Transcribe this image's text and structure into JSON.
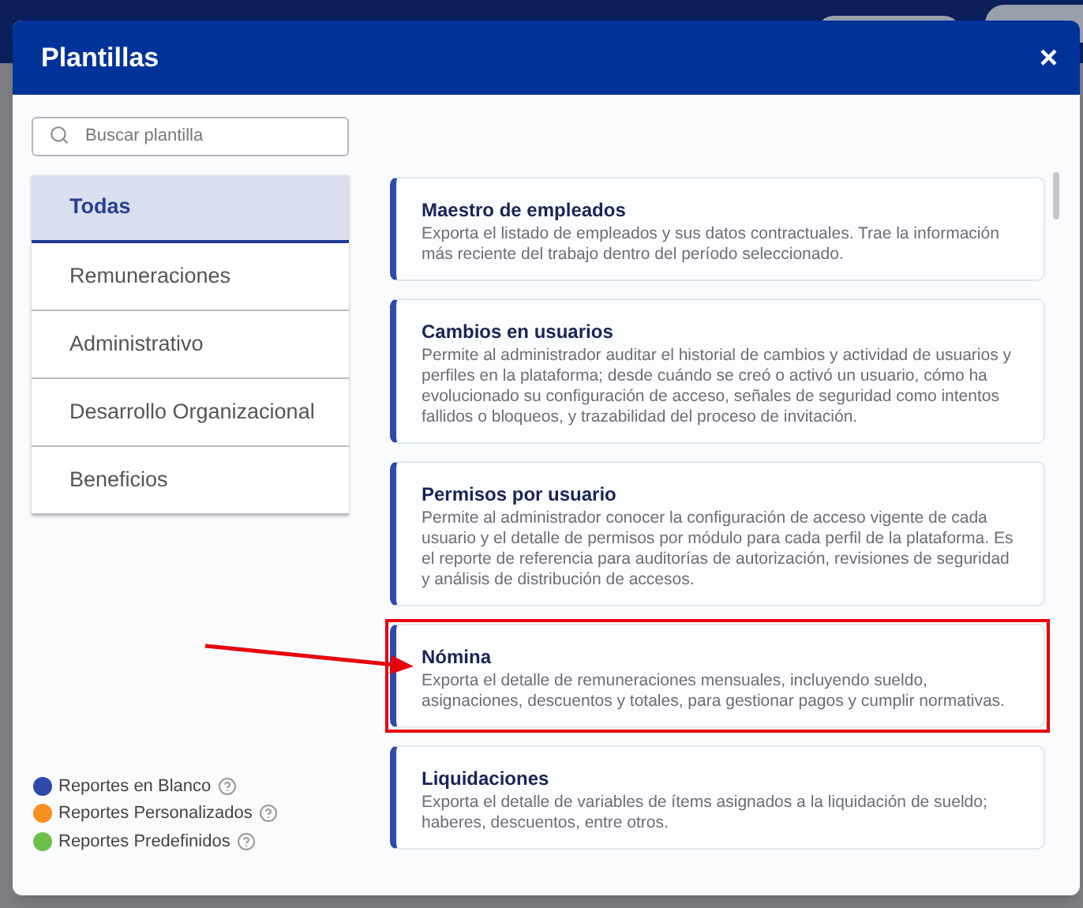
{
  "dialog": {
    "title": "Plantillas",
    "close": "×"
  },
  "search": {
    "placeholder": "Buscar plantilla"
  },
  "categories": [
    {
      "label": "Todas",
      "selected": true
    },
    {
      "label": "Remuneraciones",
      "selected": false
    },
    {
      "label": "Administrativo",
      "selected": false
    },
    {
      "label": "Desarrollo Organizacional",
      "selected": false
    },
    {
      "label": "Beneficios",
      "selected": false
    }
  ],
  "templates": [
    {
      "title": "Maestro de empleados",
      "description": "Exporta el listado de empleados y sus datos contractuales. Trae la información más reciente del trabajo dentro del período seleccionado.",
      "color": "#2e4bab",
      "highlighted": false
    },
    {
      "title": "Cambios en usuarios",
      "description": "Permite al administrador auditar el historial de cambios y actividad de usuarios y perfiles en la plataforma; desde cuándo se creó o activó un usuario, cómo ha evolucionado su configuración de acceso, señales de seguridad como intentos fallidos o bloqueos, y trazabilidad del proceso de invitación.",
      "color": "#2e4bab",
      "highlighted": false
    },
    {
      "title": "Permisos por usuario",
      "description": "Permite al administrador conocer la configuración de acceso vigente de cada usuario y el detalle de permisos por módulo para cada perfil de la plataforma. Es el reporte de referencia para auditorías de autorización, revisiones de seguridad y análisis de distribución de accesos.",
      "color": "#2e4bab",
      "highlighted": false
    },
    {
      "title": "Nómina",
      "description": "Exporta el detalle de remuneraciones mensuales, incluyendo sueldo, asignaciones, descuentos y totales, para gestionar pagos y cumplir normativas.",
      "color": "#2e4bab",
      "highlighted": true
    },
    {
      "title": "Liquidaciones",
      "description": "Exporta el detalle de variables de ítems asignados a la liquidación de sueldo; haberes, descuentos, entre otros.",
      "color": "#2e4bab",
      "highlighted": false
    }
  ],
  "legend": [
    {
      "label": "Reportes en Blanco",
      "color": "#2e4bab"
    },
    {
      "label": "Reportes Personalizados",
      "color": "#f7901e"
    },
    {
      "label": "Reportes Predefinidos",
      "color": "#6cc04a"
    }
  ]
}
